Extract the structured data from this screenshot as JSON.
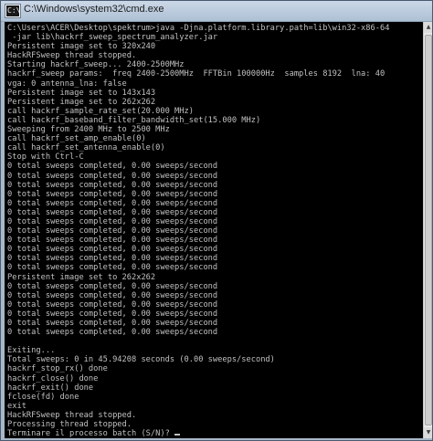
{
  "window": {
    "title": "C:\\Windows\\system32\\cmd.exe",
    "icon_name": "cmd-icon",
    "icon_glyph": "C:\\"
  },
  "console": {
    "lines": [
      "C:\\Users\\ACER\\Desktop\\spektrum>java -Djna.platform.library.path=lib\\win32-x86-64",
      " -jar lib\\hackrf_sweep_spectrum_analyzer.jar",
      "Persistent image set to 320x240",
      "HackRFSweep thread stopped.",
      "Starting hackrf_sweep... 2400-2500MHz",
      "hackrf_sweep params:  freq 2400-2500MHz  FFTBin 100000Hz  samples 8192  lna: 40",
      "vga: 0 antenna_lna: false",
      "Persistent image set to 143x143",
      "Persistent image set to 262x262",
      "call hackrf_sample_rate_set(20.000 MHz)",
      "call hackrf_baseband_filter_bandwidth_set(15.000 MHz)",
      "Sweeping from 2400 MHz to 2500 MHz",
      "call hackrf_set_amp_enable(0)",
      "call hackrf_set_antenna_enable(0)",
      "Stop with Ctrl-C",
      "0 total sweeps completed, 0.00 sweeps/second",
      "0 total sweeps completed, 0.00 sweeps/second",
      "0 total sweeps completed, 0.00 sweeps/second",
      "0 total sweeps completed, 0.00 sweeps/second",
      "0 total sweeps completed, 0.00 sweeps/second",
      "0 total sweeps completed, 0.00 sweeps/second",
      "0 total sweeps completed, 0.00 sweeps/second",
      "0 total sweeps completed, 0.00 sweeps/second",
      "0 total sweeps completed, 0.00 sweeps/second",
      "0 total sweeps completed, 0.00 sweeps/second",
      "0 total sweeps completed, 0.00 sweeps/second",
      "0 total sweeps completed, 0.00 sweeps/second",
      "Persistent image set to 262x262",
      "0 total sweeps completed, 0.00 sweeps/second",
      "0 total sweeps completed, 0.00 sweeps/second",
      "0 total sweeps completed, 0.00 sweeps/second",
      "0 total sweeps completed, 0.00 sweeps/second",
      "0 total sweeps completed, 0.00 sweeps/second",
      "0 total sweeps completed, 0.00 sweeps/second",
      "",
      "Exiting...",
      "Total sweeps: 0 in 45.94208 seconds (0.00 sweeps/second)",
      "hackrf_stop_rx() done",
      "hackrf_close() done",
      "hackrf_exit() done",
      "fclose(fd) done",
      "exit",
      "HackRFSweep thread stopped.",
      "Processing thread stopped."
    ],
    "prompt": "Terminare il processo batch (S/N)? "
  },
  "scrollbar": {
    "up_arrow_icon": "scroll-up-arrow-icon",
    "down_arrow_icon": "scroll-down-arrow-icon"
  }
}
